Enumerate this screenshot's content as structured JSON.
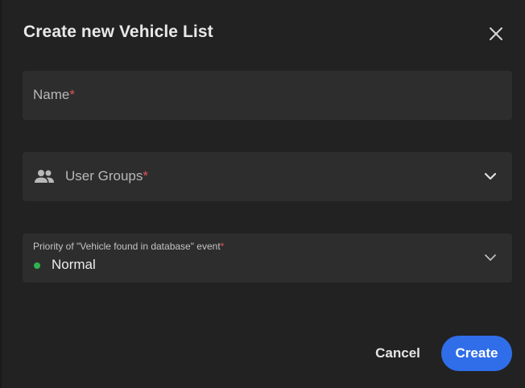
{
  "dialog": {
    "title": "Create new Vehicle List"
  },
  "fields": {
    "name": {
      "placeholder": "Name",
      "required_mark": "*"
    },
    "user_groups": {
      "placeholder": "User Groups",
      "required_mark": "*",
      "icon": "people-icon"
    },
    "priority": {
      "label": "Priority of \"Vehicle found in database\" event",
      "required_mark": "*",
      "value": "Normal",
      "status_color": "#2fb34f"
    }
  },
  "actions": {
    "cancel_label": "Cancel",
    "create_label": "Create"
  },
  "colors": {
    "background": "#222222",
    "field_background": "#2d2d2d",
    "accent": "#2f6ee8",
    "required": "#e0535b"
  }
}
